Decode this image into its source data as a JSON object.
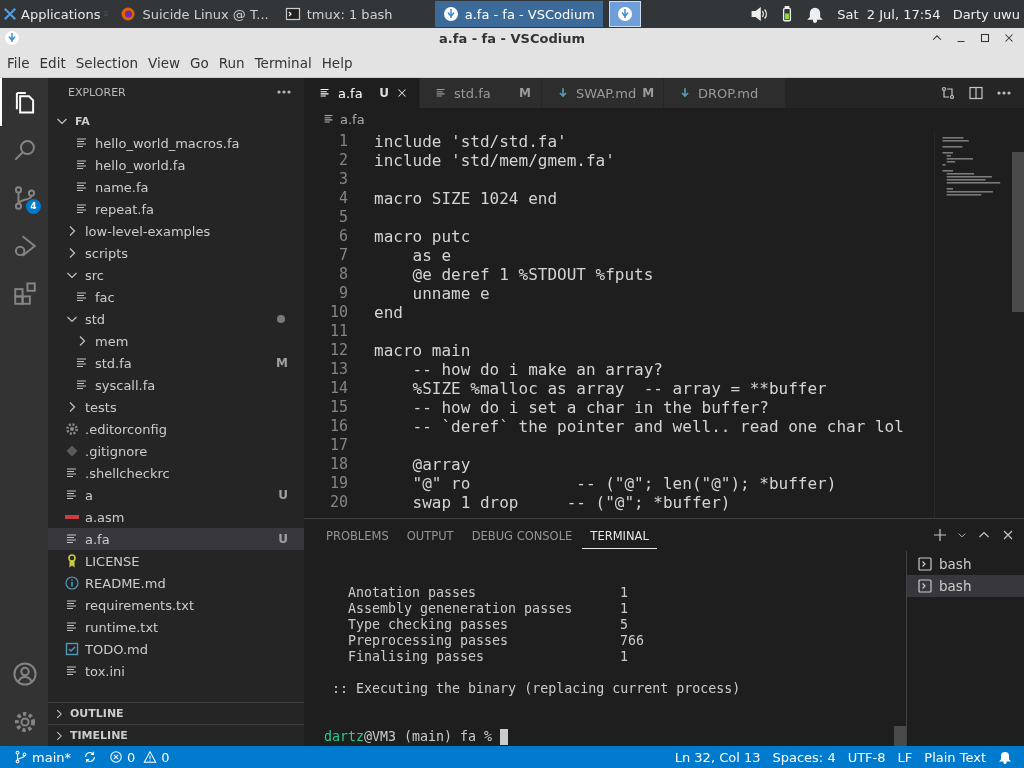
{
  "taskbar": {
    "apps_menu": "Applications",
    "windows": [
      {
        "title": "Suicide Linux @ T...",
        "selected": false
      },
      {
        "title": "tmux: 1 bash",
        "selected": false
      },
      {
        "title": "a.fa - fa - VSCodium",
        "selected": true
      },
      {
        "selected": true
      }
    ],
    "clock": "Sat  2 Jul, 17:54",
    "user": "Darty uwu"
  },
  "window": {
    "title": "a.fa - fa - VSCodium"
  },
  "menu": [
    "File",
    "Edit",
    "Selection",
    "View",
    "Go",
    "Run",
    "Terminal",
    "Help"
  ],
  "activity_bar": {
    "items": [
      {
        "selected": true
      },
      {
        "selected": false
      },
      {
        "selected": false,
        "badge": "4"
      },
      {
        "selected": false
      },
      {
        "selected": false
      }
    ],
    "bottom": [
      {
        "selected": false
      },
      {
        "selected": false
      }
    ]
  },
  "sidebar": {
    "title": "EXPLORER",
    "tree": [
      {
        "label": "FA",
        "expanded": true,
        "selected": false,
        "children": [
          {
            "children": [
              {
                "label": "hello_world_macros.fa",
                "kind": "text",
                "selected": false
              },
              {
                "label": "hello_world.fa",
                "kind": "text",
                "selected": false
              },
              {
                "label": "name.fa",
                "kind": "text",
                "selected": false
              },
              {
                "label": "repeat.fa",
                "kind": "text",
                "selected": false
              }
            ]
          },
          {
            "label": "low-level-examples",
            "expanded": false,
            "selected": false
          },
          {
            "label": "scripts",
            "expanded": false,
            "selected": false
          },
          {
            "label": "src",
            "expanded": true,
            "selected": false,
            "children": [
              {
                "label": "fac",
                "kind": "text",
                "selected": false
              }
            ]
          },
          {
            "label": "std",
            "expanded": true,
            "selected": false,
            "has_changes": true,
            "children": [
              {
                "label": "mem",
                "expanded": false,
                "selected": false
              },
              {
                "label": "std.fa",
                "kind": "text",
                "selected": false,
                "badge": "M"
              },
              {
                "label": "syscall.fa",
                "kind": "text",
                "selected": false
              }
            ]
          },
          {
            "label": "tests",
            "expanded": false,
            "selected": false
          },
          {
            "label": ".editorconfig",
            "kind": "config",
            "selected": false
          },
          {
            "label": ".gitignore",
            "kind": "git",
            "selected": false
          },
          {
            "label": ".shellcheckrc",
            "kind": "text",
            "selected": false
          },
          {
            "label": "a",
            "kind": "text",
            "selected": false,
            "badge": "U"
          },
          {
            "label": "a.asm",
            "kind": "asm",
            "selected": false
          },
          {
            "label": "a.fa",
            "kind": "text",
            "selected": true,
            "badge": "U"
          },
          {
            "label": "LICENSE",
            "kind": "license",
            "selected": false
          },
          {
            "label": "README.md",
            "kind": "readme",
            "selected": false
          },
          {
            "label": "requirements.txt",
            "kind": "text",
            "selected": false
          },
          {
            "label": "runtime.txt",
            "kind": "text",
            "selected": false
          },
          {
            "label": "TODO.md",
            "kind": "todo",
            "selected": false
          },
          {
            "label": "tox.ini",
            "kind": "text",
            "selected": false
          }
        ]
      }
    ],
    "sections": [
      {
        "label": "OUTLINE",
        "expanded": false
      },
      {
        "label": "TIMELINE",
        "expanded": false
      }
    ]
  },
  "editor": {
    "tabs": [
      {
        "label": "a.fa",
        "kind": "text",
        "badge": "U",
        "selected": true
      },
      {
        "label": "std.fa",
        "kind": "text",
        "badge": "M",
        "selected": false
      },
      {
        "label": "SWAP.md",
        "kind": "markdown",
        "badge": "M",
        "selected": false
      },
      {
        "label": "DROP.md",
        "kind": "markdown",
        "selected": false
      }
    ],
    "breadcrumb": "a.fa",
    "lines": [
      {
        "n": "1",
        "text": "include 'std/std.fa'"
      },
      {
        "n": "2",
        "text": "include 'std/mem/gmem.fa'"
      },
      {
        "n": "3"
      },
      {
        "n": "4",
        "text": "macro SIZE 1024 end"
      },
      {
        "n": "5"
      },
      {
        "n": "6",
        "text": "macro putc"
      },
      {
        "n": "7",
        "text": "    as e"
      },
      {
        "n": "8",
        "text": "    @e deref 1 %STDOUT %fputs"
      },
      {
        "n": "9",
        "text": "    unname e"
      },
      {
        "n": "10",
        "text": "end"
      },
      {
        "n": "11"
      },
      {
        "n": "12",
        "text": "macro main"
      },
      {
        "n": "13",
        "text": "    -- how do i make an array?"
      },
      {
        "n": "14",
        "text": "    %SIZE %malloc as array  -- array = **buffer"
      },
      {
        "n": "15",
        "text": "    -- how do i set a char in the buffer?"
      },
      {
        "n": "16",
        "text": "    -- `deref` the pointer and well.. read one char lol"
      },
      {
        "n": "17"
      },
      {
        "n": "18",
        "text": "    @array"
      },
      {
        "n": "19",
        "text": "    \"@\" ro           -- (\"@\"; len(\"@\"); *buffer)"
      },
      {
        "n": "20",
        "text": "    swap 1 drop     -- (\"@\"; *buffer)"
      }
    ]
  },
  "panel": {
    "tabs": [
      {
        "label": "PROBLEMS",
        "selected": false
      },
      {
        "label": "OUTPUT",
        "selected": false
      },
      {
        "label": "DEBUG CONSOLE",
        "selected": false
      },
      {
        "label": "TERMINAL",
        "selected": true
      }
    ],
    "terminal": {
      "stats": [
        {
          "label": "Anotation passes",
          "value": "1"
        },
        {
          "label": "Assembly geneneration passes",
          "value": "1"
        },
        {
          "label": "Type checking passes",
          "value": "5"
        },
        {
          "label": "Preprocessing passes",
          "value": "766"
        },
        {
          "label": "Finalising passes",
          "value": "1"
        }
      ],
      "message": ":: Executing the binary (replacing current process)",
      "prompt": {
        "user": "dartz",
        "rest": "@VM3 (main) fa %"
      }
    },
    "terminals": [
      {
        "label": "bash",
        "selected": false
      },
      {
        "label": "bash",
        "selected": true
      }
    ]
  },
  "status_bar": {
    "branch": "main*",
    "errors": "0",
    "warnings": "0",
    "right": [
      "Ln 32, Col 13",
      "Spaces: 4",
      "UTF-8",
      "LF",
      "Plain Text"
    ]
  }
}
